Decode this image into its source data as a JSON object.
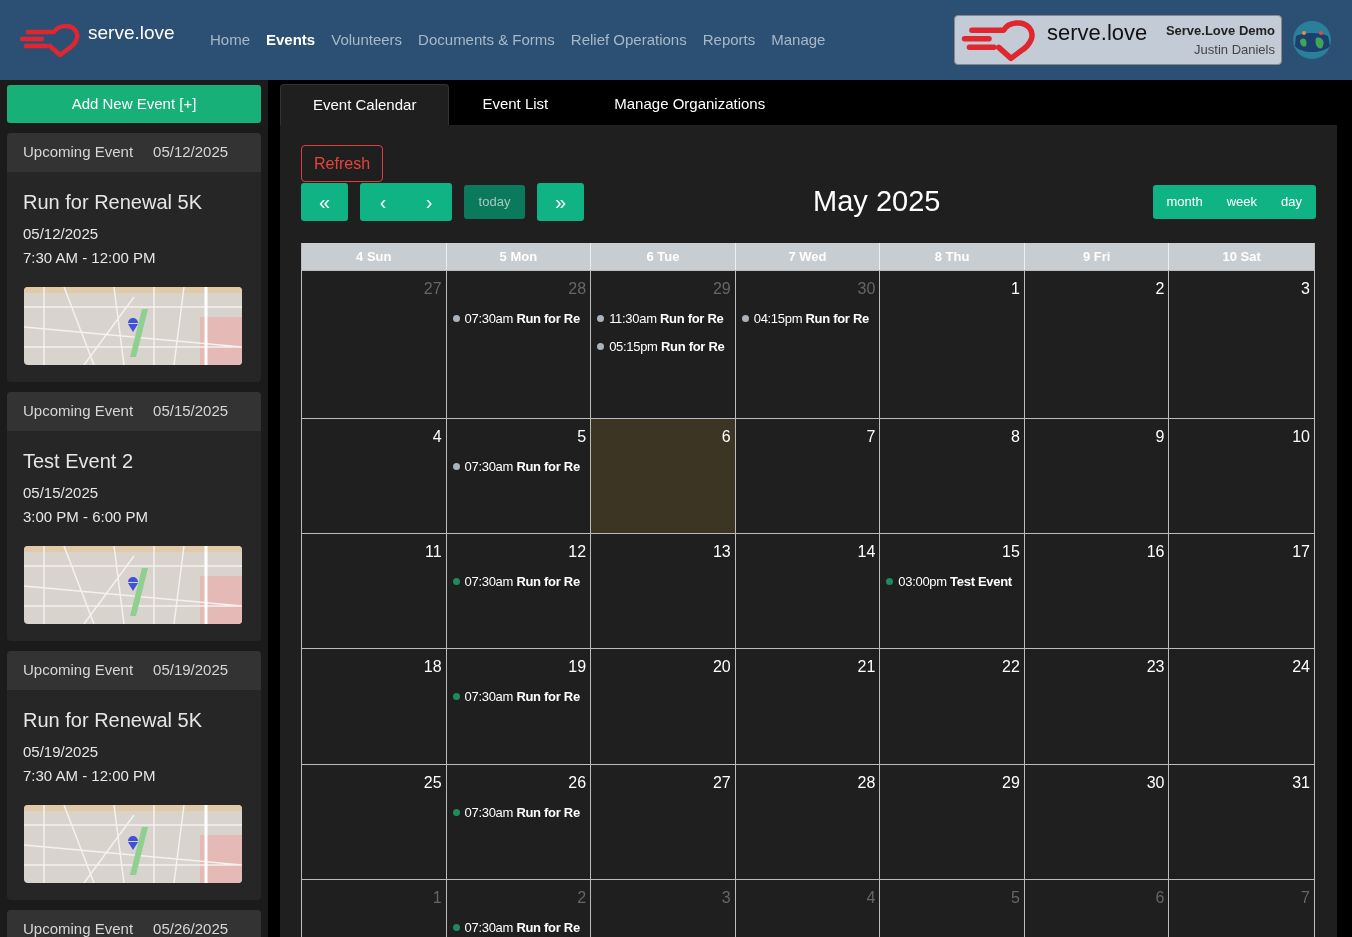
{
  "brand": {
    "name": "serve.love"
  },
  "nav": [
    {
      "label": "Home",
      "selected": false
    },
    {
      "label": "Events",
      "selected": true
    },
    {
      "label": "Volunteers",
      "selected": false
    },
    {
      "label": "Documents & Forms",
      "selected": false
    },
    {
      "label": "Relief Operations",
      "selected": false
    },
    {
      "label": "Reports",
      "selected": false
    },
    {
      "label": "Manage",
      "selected": false
    }
  ],
  "account": {
    "logo_text": "serve.love",
    "org": "Serve.Love Demo",
    "user": "Justin Daniels"
  },
  "sidebar": {
    "add_button": "Add New Event [+]",
    "cards": [
      {
        "label": "Upcoming Event",
        "header_date": "05/12/2025",
        "title": "Run for Renewal 5K",
        "date": "05/12/2025",
        "time": "7:30 AM - 12:00 PM"
      },
      {
        "label": "Upcoming Event",
        "header_date": "05/15/2025",
        "title": "Test Event 2",
        "date": "05/15/2025",
        "time": "3:00 PM - 6:00 PM"
      },
      {
        "label": "Upcoming Event",
        "header_date": "05/19/2025",
        "title": "Run for Renewal 5K",
        "date": "05/19/2025",
        "time": "7:30 AM - 12:00 PM"
      },
      {
        "label": "Upcoming Event",
        "header_date": "05/26/2025"
      }
    ]
  },
  "tabs": [
    {
      "label": "Event Calendar",
      "selected": true
    },
    {
      "label": "Event List",
      "selected": false
    },
    {
      "label": "Manage Organizations",
      "selected": false
    }
  ],
  "calendar": {
    "refresh": "Refresh",
    "title": "May 2025",
    "nav_buttons": [
      {
        "kind": "single",
        "items": [
          {
            "label": "«",
            "disabled": false
          }
        ]
      },
      {
        "kind": "group",
        "items": [
          {
            "label": "‹",
            "disabled": false
          },
          {
            "label": "›",
            "disabled": false
          }
        ]
      },
      {
        "kind": "single",
        "items": [
          {
            "label": "today",
            "disabled": true
          }
        ]
      },
      {
        "kind": "single",
        "items": [
          {
            "label": "»",
            "disabled": false
          }
        ]
      }
    ],
    "views": [
      "month",
      "week",
      "day"
    ],
    "weekdays": [
      "4 Sun",
      "5 Mon",
      "6 Tue",
      "7 Wed",
      "8 Thu",
      "9 Fri",
      "10 Sat"
    ],
    "weeks": [
      [
        {
          "day": "27",
          "other_month": true,
          "today": false
        },
        {
          "day": "28",
          "other_month": true,
          "today": false,
          "events": [
            {
              "time": "07:30am",
              "title": "Run for Re",
              "color": "#aab2bb"
            }
          ]
        },
        {
          "day": "29",
          "other_month": true,
          "today": false,
          "events": [
            {
              "time": "11:30am",
              "title": "Run for Re",
              "color": "#aab2bb"
            },
            {
              "time": "05:15pm",
              "title": "Run for Re",
              "color": "#aab2bb"
            }
          ]
        },
        {
          "day": "30",
          "other_month": true,
          "today": false,
          "events": [
            {
              "time": "04:15pm",
              "title": "Run for Re",
              "color": "#aab2bb"
            }
          ]
        },
        {
          "day": "1",
          "other_month": false,
          "today": false
        },
        {
          "day": "2",
          "other_month": false,
          "today": false
        },
        {
          "day": "3",
          "other_month": false,
          "today": false
        }
      ],
      [
        {
          "day": "4",
          "other_month": false,
          "today": false
        },
        {
          "day": "5",
          "other_month": false,
          "today": false,
          "events": [
            {
              "time": "07:30am",
              "title": "Run for Re",
              "color": "#aab2bb"
            }
          ]
        },
        {
          "day": "6",
          "other_month": false,
          "today": true
        },
        {
          "day": "7",
          "other_month": false,
          "today": false
        },
        {
          "day": "8",
          "other_month": false,
          "today": false
        },
        {
          "day": "9",
          "other_month": false,
          "today": false
        },
        {
          "day": "10",
          "other_month": false,
          "today": false
        }
      ],
      [
        {
          "day": "11",
          "other_month": false,
          "today": false
        },
        {
          "day": "12",
          "other_month": false,
          "today": false,
          "events": [
            {
              "time": "07:30am",
              "title": "Run for Re",
              "color": "#1e8a5e"
            }
          ]
        },
        {
          "day": "13",
          "other_month": false,
          "today": false
        },
        {
          "day": "14",
          "other_month": false,
          "today": false
        },
        {
          "day": "15",
          "other_month": false,
          "today": false,
          "events": [
            {
              "time": "03:00pm",
              "title": "Test Event",
              "color": "#1e8a5e"
            }
          ]
        },
        {
          "day": "16",
          "other_month": false,
          "today": false
        },
        {
          "day": "17",
          "other_month": false,
          "today": false
        }
      ],
      [
        {
          "day": "18",
          "other_month": false,
          "today": false
        },
        {
          "day": "19",
          "other_month": false,
          "today": false,
          "events": [
            {
              "time": "07:30am",
              "title": "Run for Re",
              "color": "#1e8a5e"
            }
          ]
        },
        {
          "day": "20",
          "other_month": false,
          "today": false
        },
        {
          "day": "21",
          "other_month": false,
          "today": false
        },
        {
          "day": "22",
          "other_month": false,
          "today": false
        },
        {
          "day": "23",
          "other_month": false,
          "today": false
        },
        {
          "day": "24",
          "other_month": false,
          "today": false
        }
      ],
      [
        {
          "day": "25",
          "other_month": false,
          "today": false
        },
        {
          "day": "26",
          "other_month": false,
          "today": false,
          "events": [
            {
              "time": "07:30am",
              "title": "Run for Re",
              "color": "#1e8a5e"
            }
          ]
        },
        {
          "day": "27",
          "other_month": false,
          "today": false
        },
        {
          "day": "28",
          "other_month": false,
          "today": false
        },
        {
          "day": "29",
          "other_month": false,
          "today": false
        },
        {
          "day": "30",
          "other_month": false,
          "today": false
        },
        {
          "day": "31",
          "other_month": false,
          "today": false
        }
      ],
      [
        {
          "day": "1",
          "other_month": true,
          "today": false
        },
        {
          "day": "2",
          "other_month": true,
          "today": false,
          "events": [
            {
              "time": "07:30am",
              "title": "Run for Re",
              "color": "#1e8a5e"
            }
          ]
        },
        {
          "day": "3",
          "other_month": true,
          "today": false
        },
        {
          "day": "4",
          "other_month": true,
          "today": false
        },
        {
          "day": "5",
          "other_month": true,
          "today": false
        },
        {
          "day": "6",
          "other_month": true,
          "today": false
        },
        {
          "day": "7",
          "other_month": true,
          "today": false
        }
      ]
    ]
  }
}
